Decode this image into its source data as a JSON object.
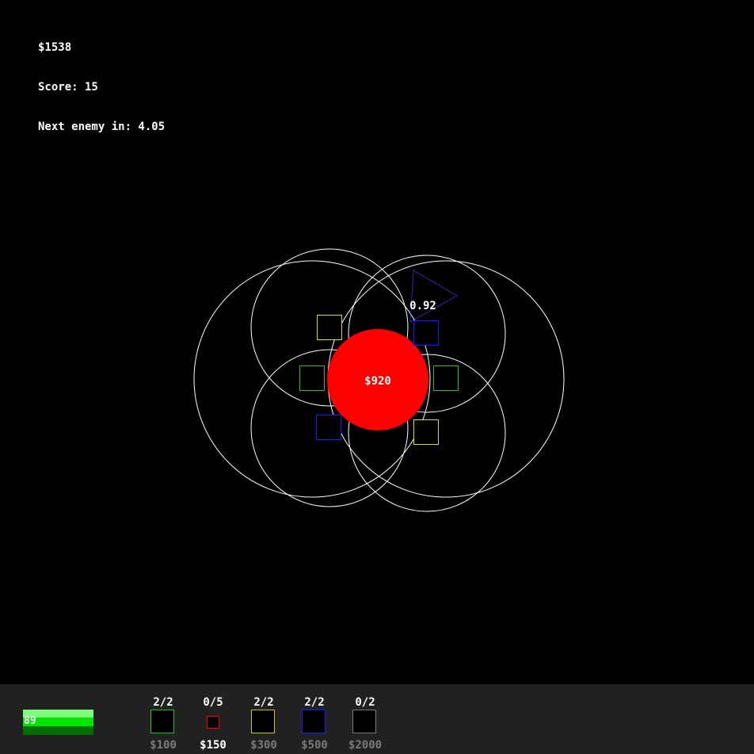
{
  "hud": {
    "money": "$1538",
    "score": "Score: 15",
    "next_enemy": "Next enemy in: 4.05"
  },
  "base": {
    "label": "$920",
    "color": "#ff0000"
  },
  "enemy": {
    "label": "0.92",
    "color": "#5a2dff"
  },
  "health": {
    "value": "89",
    "fraction": 0.89
  },
  "shop": {
    "items": [
      {
        "count": "2/2",
        "price": "$100",
        "color": "#20c020",
        "price_color": "#7a7a7a"
      },
      {
        "count": "0/5",
        "price": "$150",
        "color": "#ff0000",
        "price_color": "#ffffff"
      },
      {
        "count": "2/2",
        "price": "$300",
        "color": "#c8c800",
        "price_color": "#7a7a7a"
      },
      {
        "count": "2/2",
        "price": "$500",
        "color": "#1a1aff",
        "price_color": "#7a7a7a"
      },
      {
        "count": "0/2",
        "price": "$2000",
        "color": "#777777",
        "price_color": "#7a7a7a"
      }
    ]
  }
}
